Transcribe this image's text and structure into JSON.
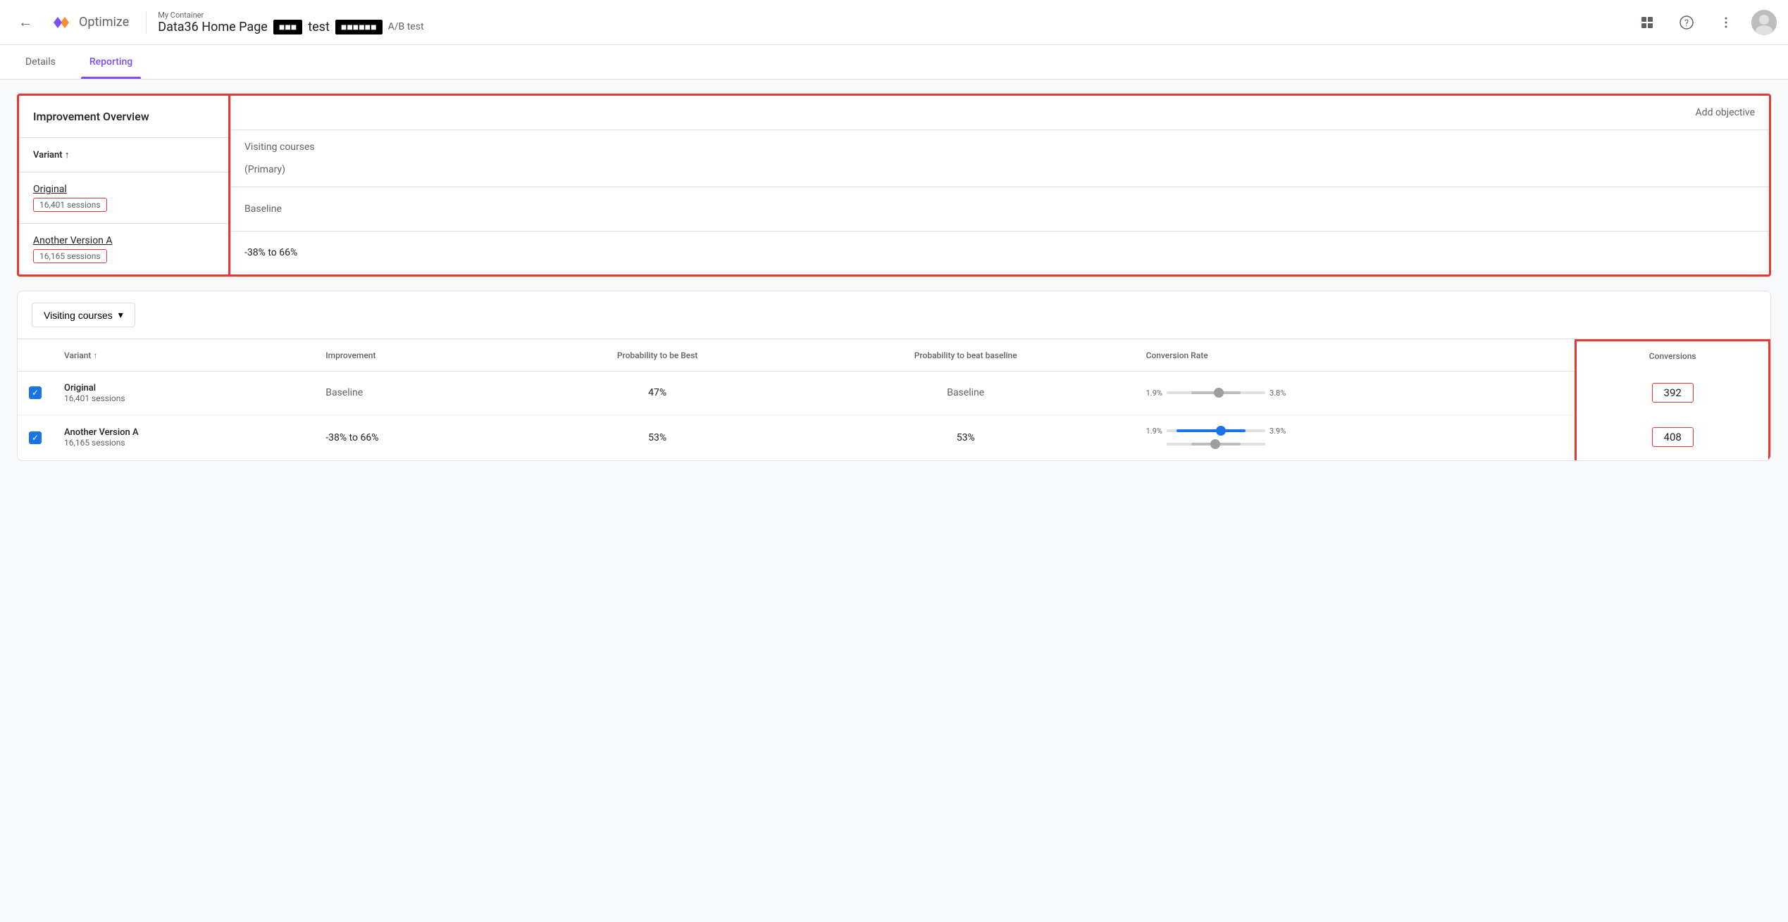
{
  "header": {
    "back_icon": "←",
    "logo_text": "Optimize",
    "container_label": "My Container",
    "experiment_title": "Data36 Home Page",
    "badge1": "■■■",
    "badge_text": "test",
    "badge2": "■■■■■■",
    "ab_test": "A/B test",
    "grid_icon": "⊞",
    "help_icon": "?",
    "more_icon": "⋮"
  },
  "tabs": {
    "details": "Details",
    "reporting": "Reporting"
  },
  "overview": {
    "title": "Improvement Overview",
    "add_objective": "Add objective",
    "variant_header": "Variant ↑",
    "visiting_courses": "Visiting courses",
    "primary": "(Primary)",
    "original_label": "Original",
    "original_sessions": "16,401 sessions",
    "original_improvement": "Baseline",
    "another_label": "Another Version A",
    "another_sessions": "16,165 sessions",
    "another_improvement": "-38% to 66%"
  },
  "data_section": {
    "dropdown_label": "Visiting courses",
    "dropdown_icon": "▾",
    "columns": {
      "variant": "Variant ↑",
      "improvement": "Improvement",
      "prob_best": "Probability to be Best",
      "prob_baseline": "Probability to beat baseline",
      "conversion_rate": "Conversion Rate",
      "conversions": "Conversions"
    },
    "rows": [
      {
        "name": "Original",
        "sessions": "16,401 sessions",
        "improvement": "Baseline",
        "prob_best": "47%",
        "prob_baseline": "Baseline",
        "rate_min": "1.9%",
        "rate_max": "3.8%",
        "conversion_value": "392"
      },
      {
        "name": "Another Version A",
        "sessions": "16,165 sessions",
        "improvement": "-38% to 66%",
        "prob_best": "53%",
        "prob_baseline": "53%",
        "rate_min": "1.9%",
        "rate_max": "3.9%",
        "conversion_value": "408"
      }
    ]
  }
}
